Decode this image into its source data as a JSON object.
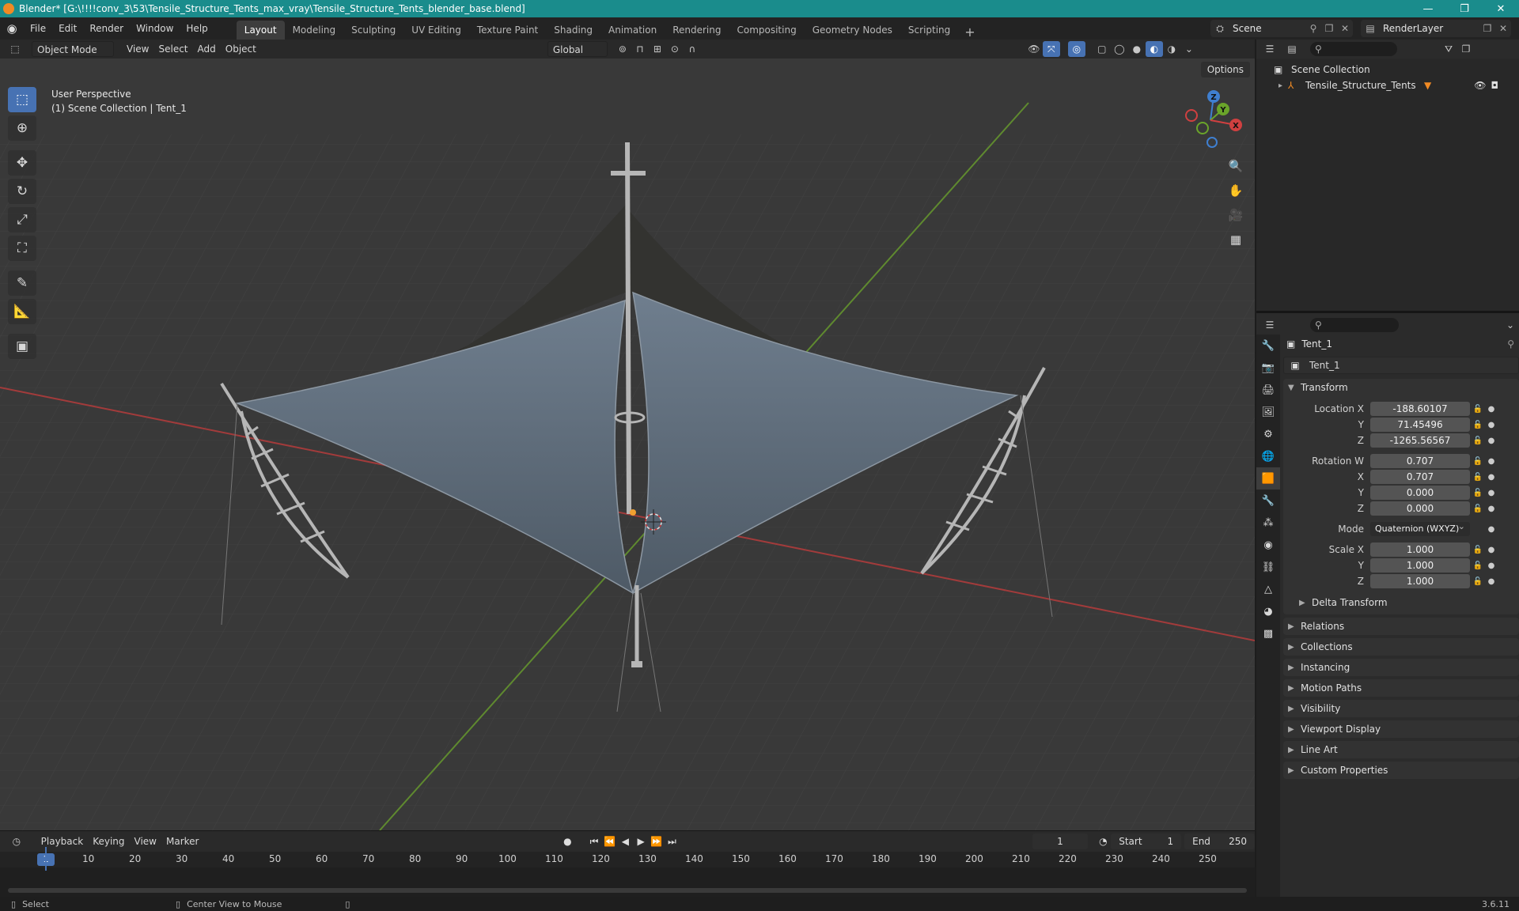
{
  "title_bar": {
    "text": "Blender* [G:\\!!!!conv_3\\53\\Tensile_Structure_Tents_max_vray\\Tensile_Structure_Tents_blender_base.blend]",
    "minimize": "—",
    "maximize": "❐",
    "close": "✕"
  },
  "menu": {
    "items": [
      "File",
      "Edit",
      "Render",
      "Window",
      "Help"
    ]
  },
  "workspaces": {
    "tabs": [
      "Layout",
      "Modeling",
      "Sculpting",
      "UV Editing",
      "Texture Paint",
      "Shading",
      "Animation",
      "Rendering",
      "Compositing",
      "Geometry Nodes",
      "Scripting"
    ],
    "active": "Layout",
    "add": "+"
  },
  "scene": {
    "name": "Scene"
  },
  "render_layer": {
    "name": "RenderLayer"
  },
  "viewport": {
    "mode": "Object Mode",
    "menus": [
      "View",
      "Select",
      "Add",
      "Object"
    ],
    "transform_orientation": "Global",
    "overlay_title": "User Perspective",
    "overlay_subtitle": "(1) Scene Collection | Tent_1",
    "options_label": "Options",
    "axis_labels": {
      "x": "X",
      "y": "Y",
      "z": "Z"
    }
  },
  "outliner": {
    "root": "Scene Collection",
    "items": [
      {
        "label": "Tensile_Structure_Tents"
      }
    ]
  },
  "properties": {
    "context_object": "Tent_1",
    "object_name": "Tent_1",
    "transform_label": "Transform",
    "location": {
      "label": "Location X",
      "x": "-188.60107",
      "y_label": "Y",
      "y": "71.45496",
      "z_label": "Z",
      "z": "-1265.56567"
    },
    "rotation": {
      "label": "Rotation W",
      "w": "0.707",
      "x_label": "X",
      "x": "0.707",
      "y_label": "Y",
      "y": "0.000",
      "z_label": "Z",
      "z": "0.000"
    },
    "mode": {
      "label": "Mode",
      "value": "Quaternion (WXYZ)"
    },
    "scale": {
      "label": "Scale X",
      "x": "1.000",
      "y_label": "Y",
      "y": "1.000",
      "z_label": "Z",
      "z": "1.000"
    },
    "delta_transform": "Delta Transform",
    "panels": [
      "Relations",
      "Collections",
      "Instancing",
      "Motion Paths",
      "Visibility",
      "Viewport Display",
      "Line Art",
      "Custom Properties"
    ]
  },
  "timeline": {
    "menus": [
      "Playback",
      "Keying",
      "View",
      "Marker"
    ],
    "current_frame": "1",
    "start_label": "Start",
    "start": "1",
    "end_label": "End",
    "end": "250",
    "ticks": [
      "10",
      "20",
      "30",
      "40",
      "50",
      "60",
      "70",
      "80",
      "90",
      "100",
      "110",
      "120",
      "130",
      "140",
      "150",
      "160",
      "170",
      "180",
      "190",
      "200",
      "210",
      "220",
      "230",
      "240",
      "250"
    ],
    "cursor_label": "1"
  },
  "status_bar": {
    "left": "Select",
    "middle": "Center View to Mouse",
    "version": "3.6.11"
  }
}
